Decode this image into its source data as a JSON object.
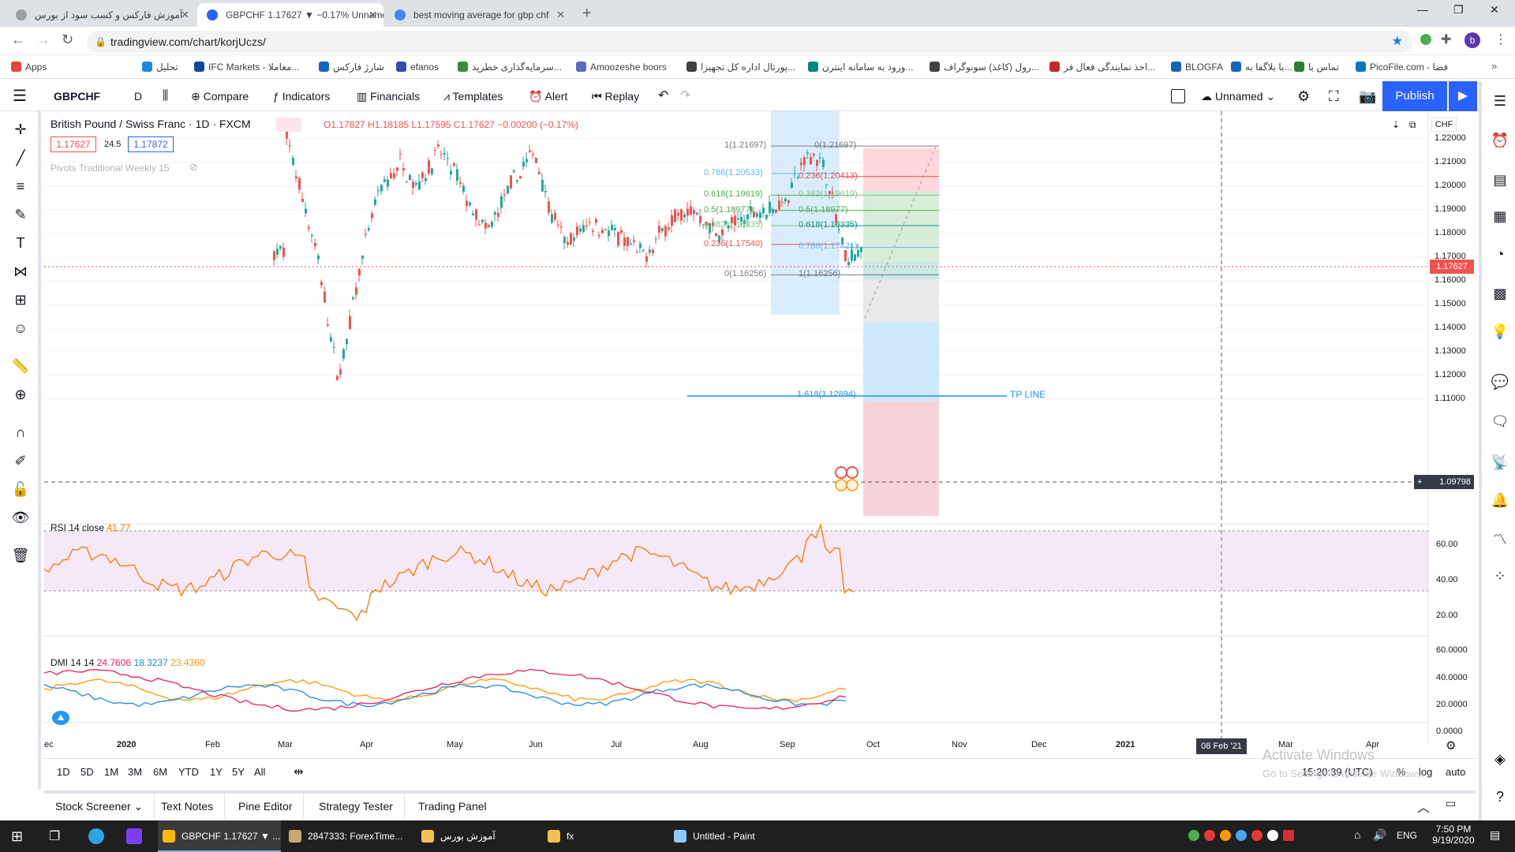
{
  "browser": {
    "tabs": [
      {
        "title": "آموزش فارکس و کسب سود از بورس",
        "active": false
      },
      {
        "title": "GBPCHF 1.17627 ▼ −0.17% Unnamed",
        "active": true
      },
      {
        "title": "best moving average for gbp chf",
        "active": false
      }
    ],
    "url": "tradingview.com/chart/korjUczs/",
    "profile_letter": "b",
    "bookmarks": [
      "Apps",
      "تحلیل",
      "IFC Markets - معاملا...",
      "شارژ فارکس",
      "efanos",
      "سرمایه‌گذاری خطرپذ...",
      "Amoozeshe boors",
      "پورتال اداره کل تجهیزا...",
      "ورود به سامانه اینترن...",
      "رول (کاغذ) سونوگراف...",
      "اخذ نمایندگی فعال فر...",
      "BLOGFA",
      "با بلاگفا به... ::",
      "تماس با",
      "PicoFile.com - فضا"
    ]
  },
  "toolbar": {
    "symbol": "GBPCHF",
    "interval": "D",
    "compare": "Compare",
    "indicators": "Indicators",
    "financials": "Financials",
    "templates": "Templates",
    "alert": "Alert",
    "replay": "Replay",
    "layout_name": "Unnamed",
    "publish": "Publish"
  },
  "legend": {
    "title": "British Pound / Swiss Franc · 1D · FXCM",
    "ohlc": "O1.17827 H1.18185 L1.17595 C1.17627 −0.00200 (−0.17%)",
    "bid": "1.17627",
    "spread": "24.5",
    "ask": "1.17872",
    "pivots": "Pivots Traditional Weekly 15",
    "currency": "CHF"
  },
  "price_axis": {
    "ticks": [
      "1.22000",
      "1.21000",
      "1.20000",
      "1.19000",
      "1.18000",
      "1.17000",
      "1.16000",
      "1.15000",
      "1.14000",
      "1.13000",
      "1.12000",
      "1.11000"
    ],
    "last_price": "1.17627",
    "crosshair_price": "1.09798"
  },
  "fib_left": [
    {
      "label": "1(1.21697)"
    },
    {
      "label": "0.786(1.20533)"
    },
    {
      "label": "0.618(1.19619)"
    },
    {
      "label": "0.5(1.18977)"
    },
    {
      "label": "0.382(1.18335)"
    },
    {
      "label": "0.236(1.17540)"
    },
    {
      "label": "0(1.16256)"
    }
  ],
  "fib_right": [
    {
      "label": "0(1.21697)"
    },
    {
      "label": "0.236(1.20413)"
    },
    {
      "label": "0.382(1.19619)"
    },
    {
      "label": "0.5(1.18977)"
    },
    {
      "label": "0.618(1.18335)"
    },
    {
      "label": "0.786(1.17421)"
    },
    {
      "label": "1(1.16256)"
    }
  ],
  "extension": {
    "label": "1.618(1.12894)",
    "tp_label": "TP LINE"
  },
  "rsi": {
    "label": "RSI 14 close",
    "value": "41.77",
    "ticks": [
      "60.00",
      "40.00",
      "20.00"
    ]
  },
  "dmi": {
    "label": "DMI 14 14",
    "v1": "24.7606",
    "v2": "18.3237",
    "v3": "23.4360",
    "ticks": [
      "60.0000",
      "40.0000",
      "20.0000",
      "0.0000"
    ]
  },
  "time_axis": {
    "ticks": [
      "ec",
      "2020",
      "Feb",
      "Mar",
      "Apr",
      "May",
      "Jun",
      "Jul",
      "Aug",
      "Sep",
      "Oct",
      "Nov",
      "Dec",
      "2021",
      "Mar",
      "Apr"
    ],
    "crosshair_date": "08 Feb '21"
  },
  "ranges": [
    "1D",
    "5D",
    "1M",
    "3M",
    "6M",
    "YTD",
    "1Y",
    "5Y",
    "All"
  ],
  "clock": "15:20:39 (UTC)",
  "scale_opts": [
    "%",
    "log",
    "auto"
  ],
  "watermark": {
    "line1": "Activate Windows",
    "line2": "Go to Settings to activate Windows."
  },
  "panels": [
    "Stock Screener",
    "Text Notes",
    "Pine Editor",
    "Strategy Tester",
    "Trading Panel"
  ],
  "taskbar": {
    "items": [
      "GBPCHF 1.17627 ▼ ...",
      "2847333: ForexTime...",
      "آموزش بورس",
      "fx",
      "Untitled - Paint"
    ],
    "lang": "ENG",
    "time": "7:50 PM",
    "date": "9/19/2020"
  },
  "colors": {
    "accent": "#2962ff",
    "down": "#ef5350",
    "up": "#26a69a",
    "rsi": "#f57c00"
  }
}
